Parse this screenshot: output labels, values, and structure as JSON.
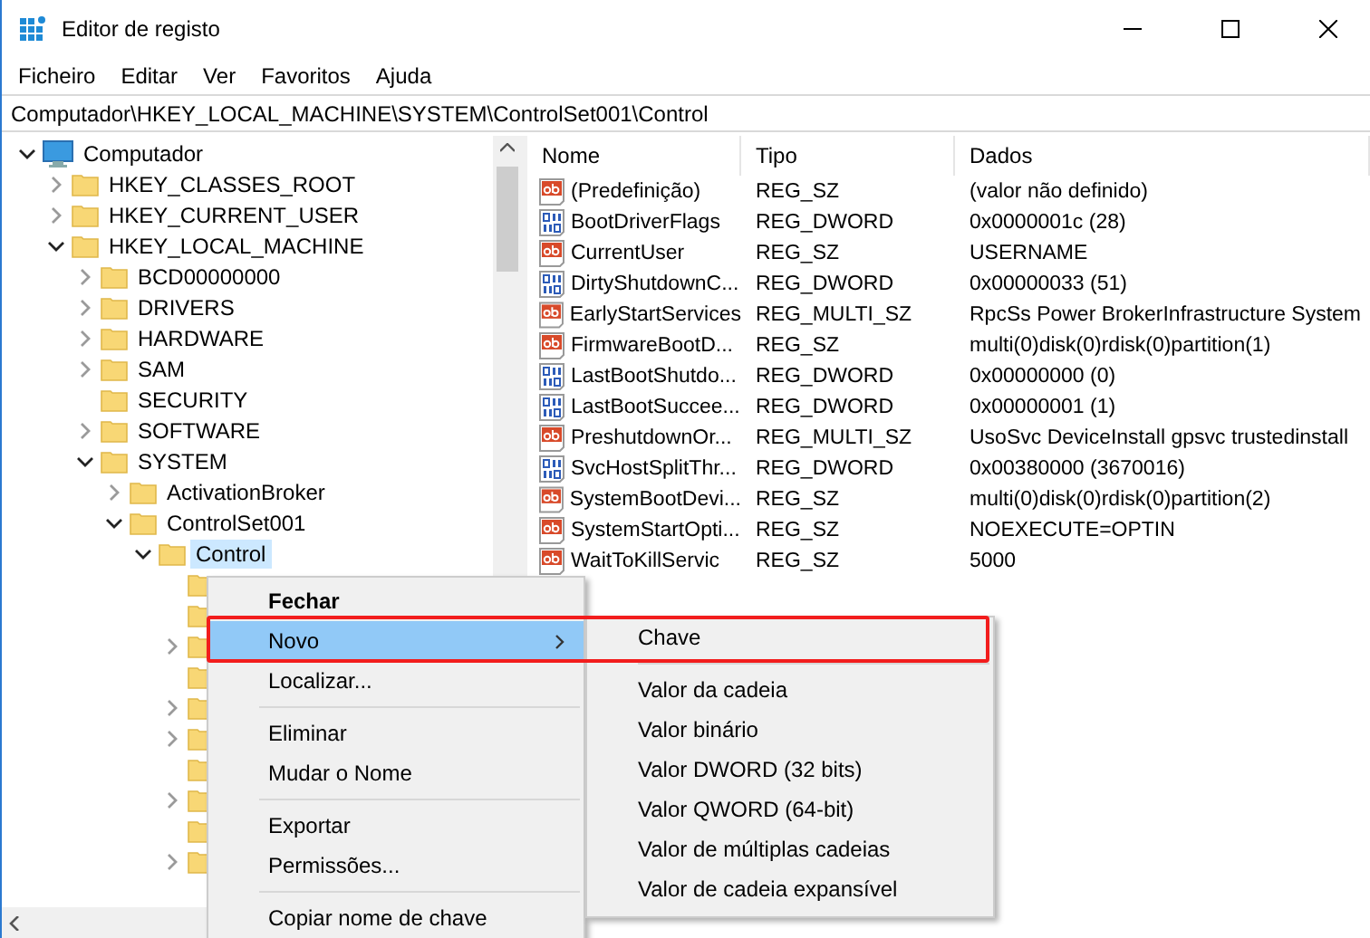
{
  "window": {
    "title": "Editor de registo"
  },
  "menu_bar": [
    "Ficheiro",
    "Editar",
    "Ver",
    "Favoritos",
    "Ajuda"
  ],
  "address": "Computador\\HKEY_LOCAL_MACHINE\\SYSTEM\\ControlSet001\\Control",
  "tree": [
    {
      "label": "Computador",
      "kind": "computer",
      "expandable": true,
      "expanded": true,
      "selected": false,
      "children": [
        {
          "label": "HKEY_CLASSES_ROOT",
          "kind": "folder",
          "expandable": true,
          "expanded": false,
          "selected": false
        },
        {
          "label": "HKEY_CURRENT_USER",
          "kind": "folder",
          "expandable": true,
          "expanded": false,
          "selected": false
        },
        {
          "label": "HKEY_LOCAL_MACHINE",
          "kind": "folder",
          "expandable": true,
          "expanded": true,
          "selected": false,
          "children": [
            {
              "label": "BCD00000000",
              "kind": "folder",
              "expandable": true,
              "expanded": false,
              "selected": false
            },
            {
              "label": "DRIVERS",
              "kind": "folder",
              "expandable": true,
              "expanded": false,
              "selected": false
            },
            {
              "label": "HARDWARE",
              "kind": "folder",
              "expandable": true,
              "expanded": false,
              "selected": false
            },
            {
              "label": "SAM",
              "kind": "folder",
              "expandable": true,
              "expanded": false,
              "selected": false
            },
            {
              "label": "SECURITY",
              "kind": "folder",
              "expandable": false,
              "selected": false
            },
            {
              "label": "SOFTWARE",
              "kind": "folder",
              "expandable": true,
              "expanded": false,
              "selected": false
            },
            {
              "label": "SYSTEM",
              "kind": "folder",
              "expandable": true,
              "expanded": true,
              "selected": false,
              "children": [
                {
                  "label": "ActivationBroker",
                  "kind": "folder",
                  "expandable": true,
                  "expanded": false,
                  "selected": false
                },
                {
                  "label": "ControlSet001",
                  "kind": "folder",
                  "expandable": true,
                  "expanded": true,
                  "selected": false,
                  "children": [
                    {
                      "label": "Control",
                      "kind": "folder",
                      "expandable": true,
                      "expanded": true,
                      "selected": true,
                      "children": [
                        {
                          "kind": "folder",
                          "expandable": false
                        },
                        {
                          "kind": "folder",
                          "expandable": false
                        },
                        {
                          "kind": "folder",
                          "expandable": true,
                          "expanded": false
                        },
                        {
                          "kind": "folder",
                          "expandable": false
                        },
                        {
                          "kind": "folder",
                          "expandable": true,
                          "expanded": false
                        },
                        {
                          "kind": "folder",
                          "expandable": true,
                          "expanded": false
                        },
                        {
                          "kind": "folder",
                          "expandable": false
                        },
                        {
                          "kind": "folder",
                          "expandable": true,
                          "expanded": false
                        },
                        {
                          "kind": "folder",
                          "expandable": false
                        },
                        {
                          "kind": "folder",
                          "expandable": true,
                          "expanded": false
                        }
                      ]
                    }
                  ]
                }
              ]
            }
          ]
        }
      ]
    }
  ],
  "columns": [
    "Nome",
    "Tipo",
    "Dados"
  ],
  "values": [
    {
      "kind": "string",
      "name": "(Predefinição)",
      "type": "REG_SZ",
      "data": "(valor não definido)"
    },
    {
      "kind": "number",
      "name": "BootDriverFlags",
      "type": "REG_DWORD",
      "data": "0x0000001c (28)"
    },
    {
      "kind": "string",
      "name": "CurrentUser",
      "type": "REG_SZ",
      "data": "USERNAME"
    },
    {
      "kind": "number",
      "name": "DirtyShutdownC...",
      "type": "REG_DWORD",
      "data": "0x00000033 (51)"
    },
    {
      "kind": "string",
      "name": "EarlyStartServices",
      "type": "REG_MULTI_SZ",
      "data": "RpcSs Power BrokerInfrastructure System"
    },
    {
      "kind": "string",
      "name": "FirmwareBootD...",
      "type": "REG_SZ",
      "data": "multi(0)disk(0)rdisk(0)partition(1)"
    },
    {
      "kind": "number",
      "name": "LastBootShutdo...",
      "type": "REG_DWORD",
      "data": "0x00000000 (0)"
    },
    {
      "kind": "number",
      "name": "LastBootSuccee...",
      "type": "REG_DWORD",
      "data": "0x00000001 (1)"
    },
    {
      "kind": "string",
      "name": "PreshutdownOr...",
      "type": "REG_MULTI_SZ",
      "data": "UsoSvc DeviceInstall gpsvc trustedinstall"
    },
    {
      "kind": "number",
      "name": "SvcHostSplitThr...",
      "type": "REG_DWORD",
      "data": "0x00380000 (3670016)"
    },
    {
      "kind": "string",
      "name": "SystemBootDevi...",
      "type": "REG_SZ",
      "data": "multi(0)disk(0)rdisk(0)partition(2)"
    },
    {
      "kind": "string",
      "name": "SystemStartOpti...",
      "type": "REG_SZ",
      "data": " NOEXECUTE=OPTIN"
    },
    {
      "kind": "string",
      "name": "WaitToKillServic",
      "type": "REG_SZ",
      "data": "5000"
    }
  ],
  "context_menu": [
    {
      "kind": "item",
      "label": "Fechar",
      "default": true,
      "selected": false,
      "submenu": false
    },
    {
      "kind": "item",
      "label": "Novo",
      "default": false,
      "selected": true,
      "submenu": true
    },
    {
      "kind": "item",
      "label": "Localizar...",
      "default": false,
      "selected": false,
      "submenu": false
    },
    {
      "kind": "separator"
    },
    {
      "kind": "item",
      "label": "Eliminar",
      "default": false,
      "selected": false,
      "submenu": false
    },
    {
      "kind": "item",
      "label": "Mudar o Nome",
      "default": false,
      "selected": false,
      "submenu": false
    },
    {
      "kind": "separator"
    },
    {
      "kind": "item",
      "label": "Exportar",
      "default": false,
      "selected": false,
      "submenu": false
    },
    {
      "kind": "item",
      "label": "Permissões...",
      "default": false,
      "selected": false,
      "submenu": false
    },
    {
      "kind": "separator"
    },
    {
      "kind": "item",
      "label": "Copiar nome de chave",
      "default": false,
      "selected": false,
      "submenu": false
    }
  ],
  "submenu": [
    {
      "kind": "item",
      "label": "Chave",
      "highlighted": true
    },
    {
      "kind": "separator"
    },
    {
      "kind": "item",
      "label": "Valor da cadeia",
      "highlighted": false
    },
    {
      "kind": "item",
      "label": "Valor binário",
      "highlighted": false
    },
    {
      "kind": "item",
      "label": "Valor DWORD (32 bits)",
      "highlighted": false
    },
    {
      "kind": "item",
      "label": "Valor QWORD (64-bit)",
      "highlighted": false
    },
    {
      "kind": "item",
      "label": "Valor de múltiplas cadeias",
      "highlighted": false
    },
    {
      "kind": "item",
      "label": "Valor de cadeia expansível",
      "highlighted": false
    }
  ]
}
